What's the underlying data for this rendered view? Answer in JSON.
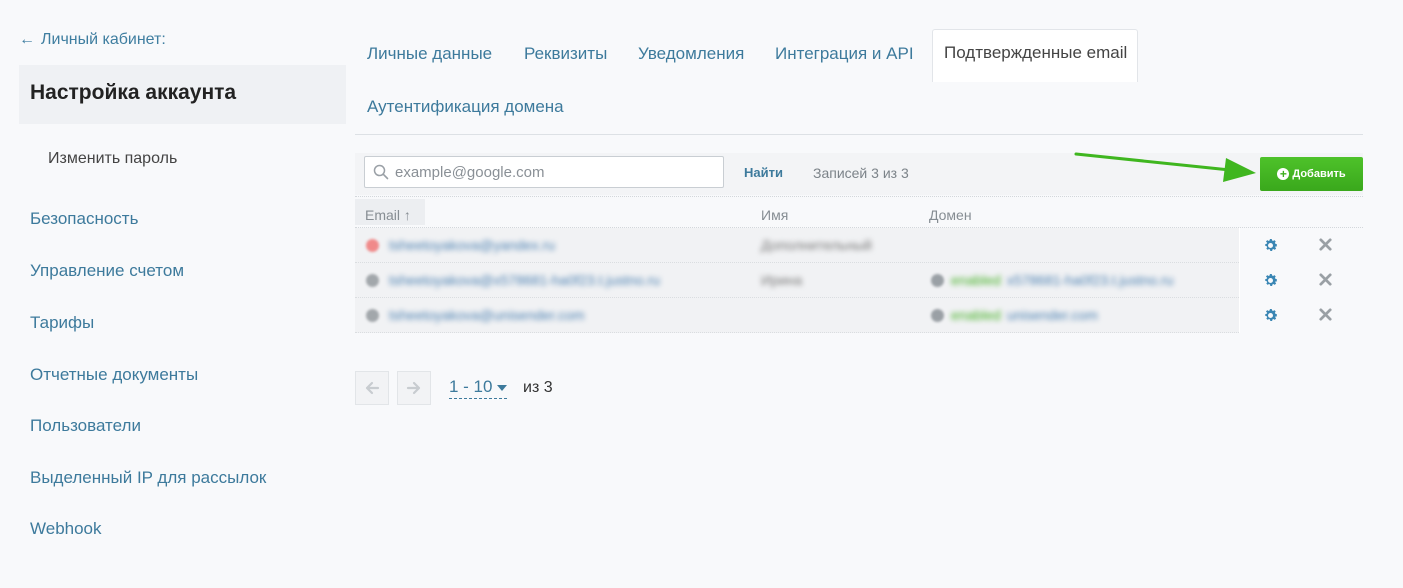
{
  "sidebar": {
    "back_label": "Личный кабинет:",
    "active_title": "Настройка аккаунта",
    "sub_item": "Изменить пароль",
    "items": [
      "Безопасность",
      "Управление счетом",
      "Тарифы",
      "Отчетные документы",
      "Пользователи",
      "Выделенный IP для рассылок",
      "Webhook"
    ]
  },
  "tabs": {
    "personal": "Личные данные",
    "requisites": "Реквизиты",
    "notifications": "Уведомления",
    "integration": "Интеграция и API",
    "confirmed": "Подтвержденные email",
    "domain_auth": "Аутентификация домена"
  },
  "toolbar": {
    "search_placeholder": "example@google.com",
    "search_value": "",
    "find_label": "Найти",
    "records_label": "Записей 3 из 3",
    "add_label": "Добавить"
  },
  "table": {
    "headers": {
      "email": "Email ↑",
      "name": "Имя",
      "domain": "Домен"
    },
    "rows": [
      {
        "email": "tsheetoyakova@yandex.ru",
        "name": "Дополнительный",
        "domain_status": "",
        "domain": "",
        "dot_color": "#f08a8a"
      },
      {
        "email": "tsheetoyakova@x578681-ha0f23.t.justno.ru",
        "name": "Ирина",
        "domain_status": "enabled",
        "domain": "x578681-ha0f23.t.justno.ru",
        "dot_color": "#a2a7ab"
      },
      {
        "email": "tsheetoyakova@unisender.com",
        "name": "",
        "domain_status": "enabled",
        "domain": "unisender.com",
        "dot_color": "#a2a7ab"
      }
    ]
  },
  "pagination": {
    "range": "1 - 10",
    "total": "из 3"
  },
  "colors": {
    "accent": "#3d7a9c",
    "add_button": "#3fae1f"
  }
}
